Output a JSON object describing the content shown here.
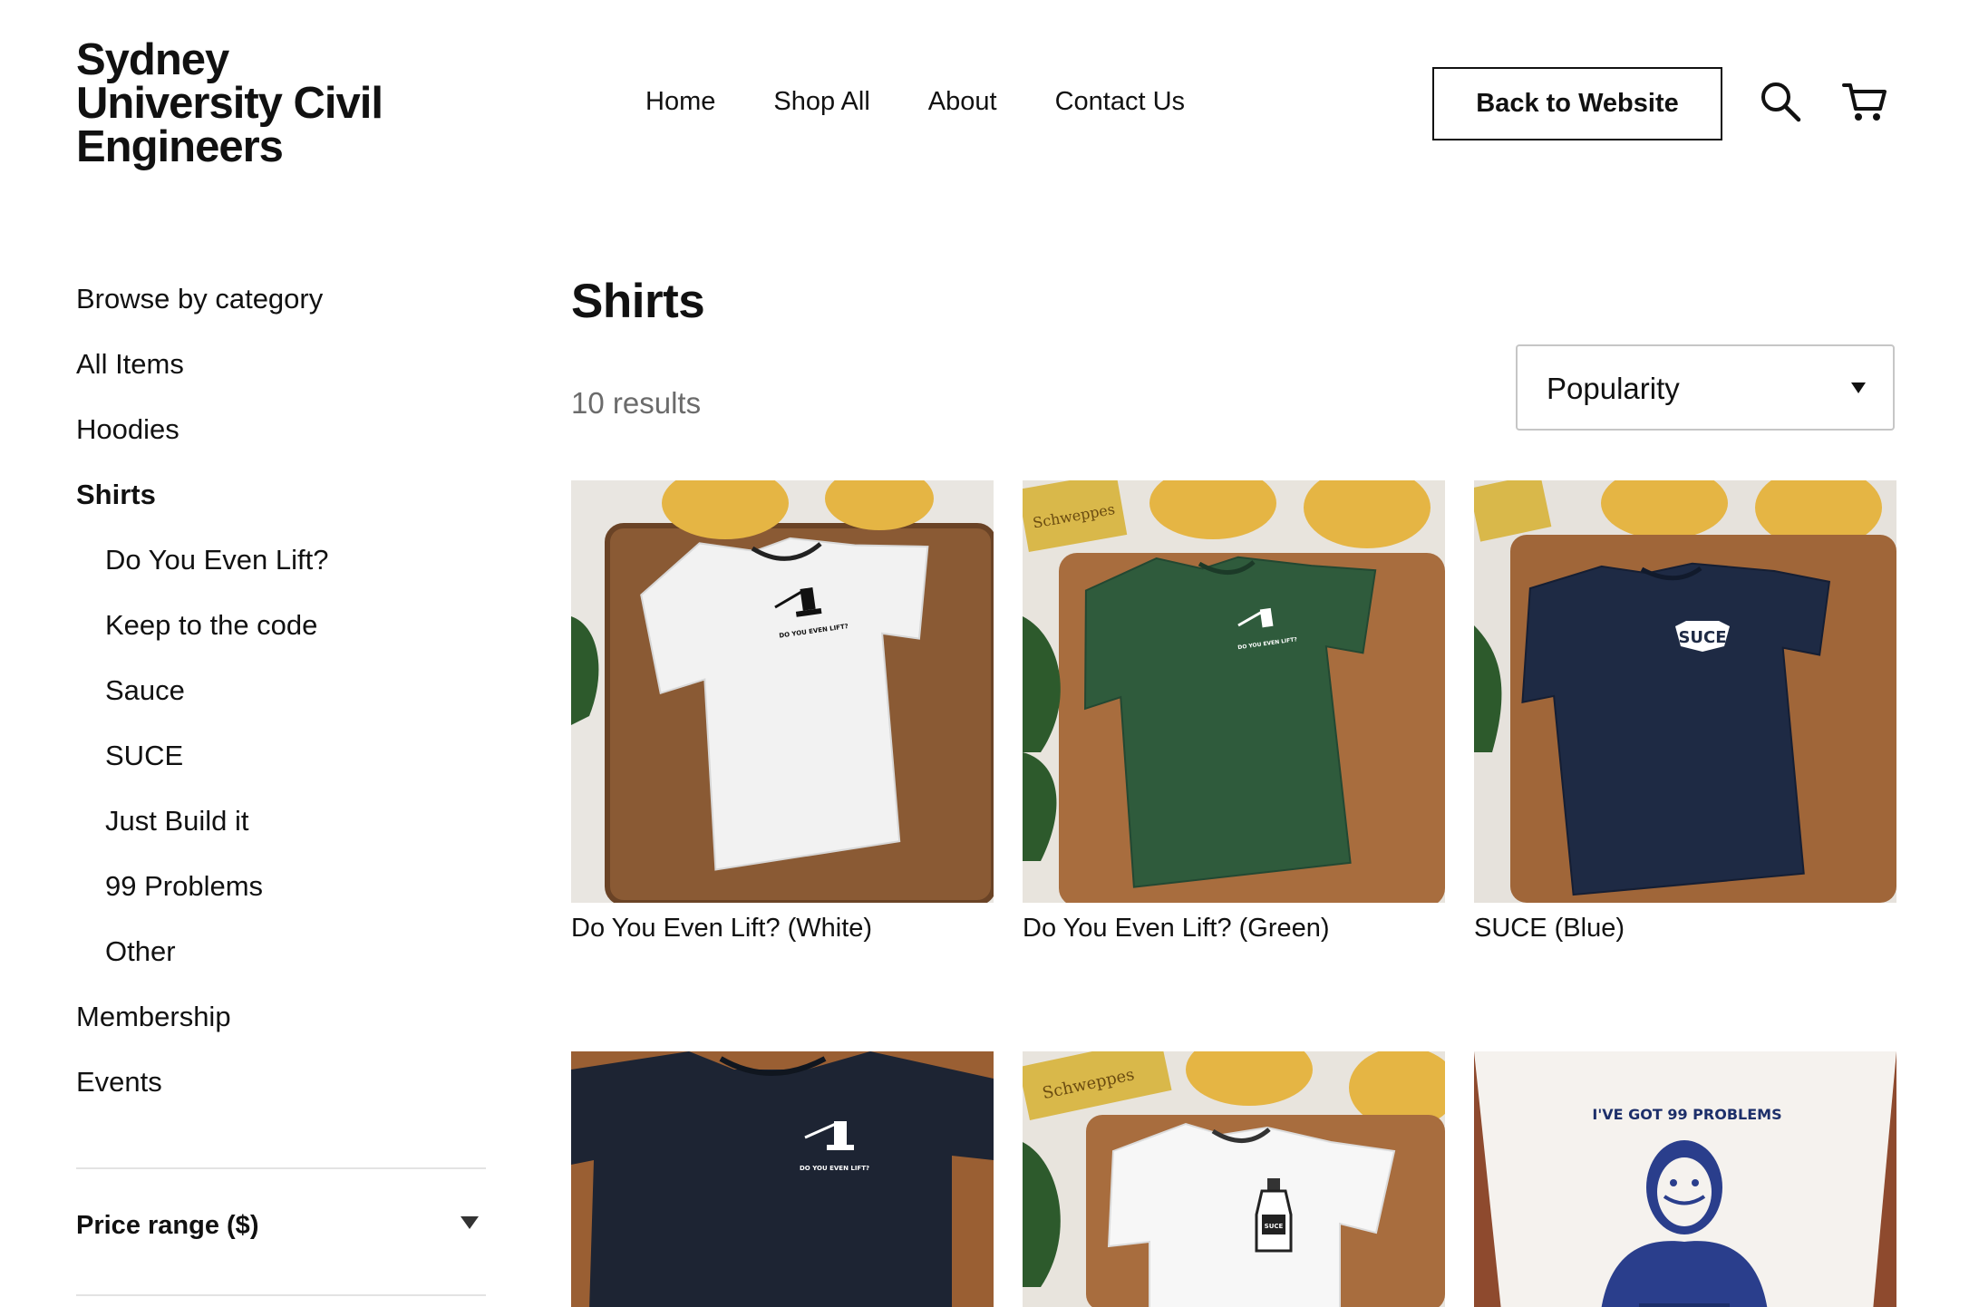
{
  "logo": {
    "line1": "Sydney",
    "line2": "University Civil",
    "line3": "Engineers"
  },
  "nav": {
    "home": "Home",
    "shop_all": "Shop All",
    "about": "About",
    "contact": "Contact Us"
  },
  "header": {
    "back_label": "Back to Website"
  },
  "sidebar": {
    "title": "Browse by category",
    "items": [
      {
        "label": "All Items"
      },
      {
        "label": "Hoodies"
      },
      {
        "label": "Shirts"
      },
      {
        "label": "Do You Even Lift?"
      },
      {
        "label": "Keep to the code"
      },
      {
        "label": "Sauce"
      },
      {
        "label": "SUCE"
      },
      {
        "label": "Just Build it"
      },
      {
        "label": "99 Problems"
      },
      {
        "label": "Other"
      },
      {
        "label": "Membership"
      },
      {
        "label": "Events"
      }
    ],
    "price_label": "Price range ($)"
  },
  "main": {
    "title": "Shirts",
    "results": "10 results",
    "sort_value": "Popularity"
  },
  "products": [
    {
      "name": "Do You Even Lift? (White)",
      "shirt_color": "#f4f4f4",
      "print_text": "DO YOU EVEN LIFT?"
    },
    {
      "name": "Do You Even Lift? (Green)",
      "shirt_color": "#2f5b3c",
      "print_text": "DO YOU EVEN LIFT?"
    },
    {
      "name": "SUCE (Blue)",
      "shirt_color": "#1e2a44",
      "print_text": "SUCE"
    },
    {
      "name": "",
      "shirt_color": "#1d2433",
      "print_text": "DO YOU EVEN LIFT?"
    },
    {
      "name": "",
      "shirt_color": "#f7f7f7",
      "print_text": "SUCE SAUCE"
    },
    {
      "name": "",
      "shirt_color": "#f5f2ee",
      "print_text": "I'VE GOT 99 PROBLEMS"
    }
  ]
}
